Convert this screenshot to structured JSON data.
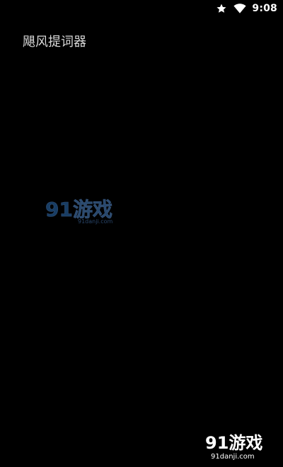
{
  "status_bar": {
    "star_icon": "star-icon",
    "wifi_icon": "wifi-icon",
    "time": "9:08"
  },
  "app": {
    "title": "飓风提词器"
  },
  "watermarks": {
    "center": {
      "logo_text": "91游戏",
      "sub_text": "91danji.com"
    },
    "bottom_right": {
      "logo_text": "91游戏",
      "sub_text": "91danji.com"
    }
  },
  "colors": {
    "background": "#000000",
    "title": "#d9d9d9",
    "status": "#ffffff",
    "watermark_blue": "#2c6fb7"
  }
}
